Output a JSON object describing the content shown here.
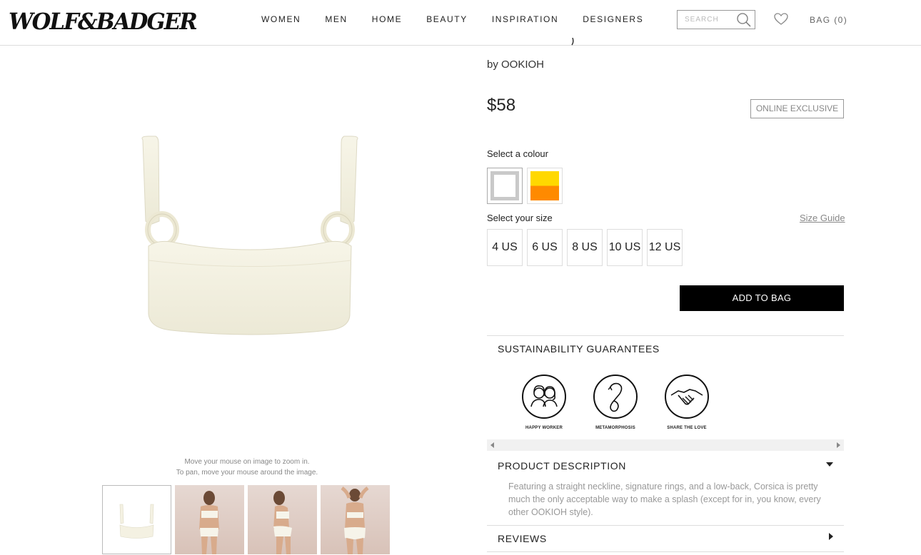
{
  "header": {
    "logo": "WOLF&BADGER",
    "nav": [
      "WOMEN",
      "MEN",
      "HOME",
      "BEAUTY",
      "INSPIRATION",
      "DESIGNERS"
    ],
    "search_placeholder": "SEARCH",
    "bag_label": "BAG (0)"
  },
  "gallery": {
    "zoom_hint_1": "Move your mouse on image to zoom in.",
    "zoom_hint_2": "To pan, move your mouse around the image.",
    "thumbnail_count": 4
  },
  "product": {
    "designer_line": "by OOKIOH",
    "price": "$58",
    "badge": "ONLINE EXCLUSIVE",
    "colour_label": "Select a colour",
    "colours": [
      {
        "name": "white",
        "hex": "#ffffff",
        "selected": true
      },
      {
        "name": "yellow-orange",
        "hex": "#ffd800",
        "selected": false
      }
    ],
    "size_label": "Select your size",
    "size_guide": "Size Guide",
    "sizes": [
      "4 US",
      "6 US",
      "8 US",
      "10 US",
      "12 US"
    ],
    "add_to_bag": "ADD TO BAG"
  },
  "sustainability": {
    "title": "SUSTAINABILITY GUARANTEES",
    "items": [
      {
        "label": "HAPPY WORKER",
        "icon": "happy-worker-icon"
      },
      {
        "label": "METAMORPHOSIS",
        "icon": "metamorphosis-icon"
      },
      {
        "label": "SHARE THE LOVE",
        "icon": "handshake-icon"
      }
    ]
  },
  "description": {
    "title": "PRODUCT DESCRIPTION",
    "text": "Featuring a straight neckline, signature rings, and a low-back, Corsica is pretty much the only acceptable way to make a splash (except for in, you know, every other OOKIOH style)."
  },
  "reviews": {
    "title": "REVIEWS"
  },
  "colors": {
    "accent": "#000000",
    "product_cream": "#f4f1e2"
  }
}
